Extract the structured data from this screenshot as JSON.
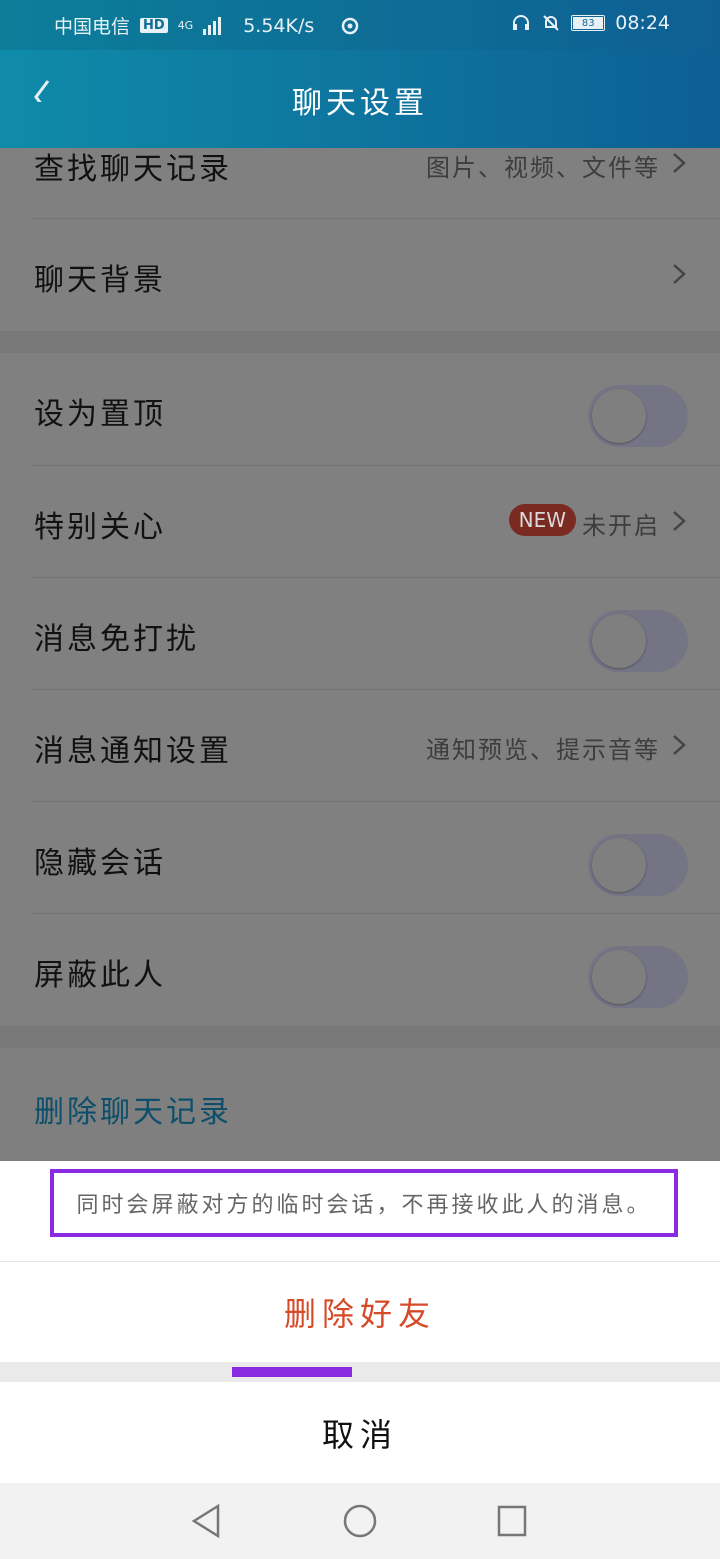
{
  "status_bar": {
    "carrier": "中国电信",
    "hd": "HD",
    "network": "4G",
    "speed": "5.54K/s",
    "battery": "83",
    "time": "08:24",
    "icons": [
      "signal-bars-icon",
      "sync-icon",
      "headset-icon",
      "bell-off-icon",
      "battery-icon"
    ]
  },
  "header": {
    "title": "聊天设置",
    "back_icon": "chevron-left-icon"
  },
  "settings": {
    "find_history": {
      "label": "查找聊天记录",
      "sub": "图片、视频、文件等"
    },
    "chat_background": {
      "label": "聊天背景"
    },
    "pin_top": {
      "label": "设为置顶",
      "enabled": false
    },
    "special_care": {
      "label": "特别关心",
      "badge": "NEW",
      "sub": "未开启"
    },
    "do_not_disturb": {
      "label": "消息免打扰",
      "enabled": false
    },
    "notification_settings": {
      "label": "消息通知设置",
      "sub": "通知预览、提示音等"
    },
    "hide_session": {
      "label": "隐藏会话",
      "enabled": false
    },
    "block_person": {
      "label": "屏蔽此人",
      "enabled": false
    },
    "delete_history": {
      "label": "删除聊天记录"
    }
  },
  "action_sheet": {
    "hint": "同时会屏蔽对方的临时会话，不再接收此人的消息。",
    "delete_friend": "删除好友",
    "cancel": "取消",
    "accent_color": "#8a2be2",
    "danger_color": "#d64a28"
  },
  "navbar": {
    "icons": [
      "back-triangle-icon",
      "home-circle-icon",
      "recents-square-icon"
    ]
  }
}
